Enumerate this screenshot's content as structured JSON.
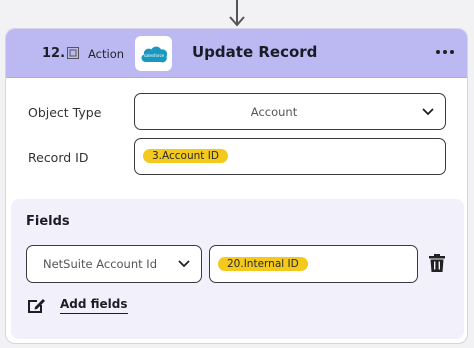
{
  "step": {
    "number": "12.",
    "type": "Action",
    "title": "Update Record"
  },
  "app": {
    "name": "salesforce",
    "brand_color": "#1798c1"
  },
  "form": {
    "object_type": {
      "label": "Object Type",
      "value": "Account"
    },
    "record_id": {
      "label": "Record ID",
      "token": "3.Account ID"
    }
  },
  "fields": {
    "title": "Fields",
    "rows": [
      {
        "field": "NetSuite Account Id",
        "token": "20.Internal ID"
      }
    ],
    "add_label": "Add fields"
  },
  "colors": {
    "header_bg": "#bcb9f2",
    "token_bg": "#f4c91d",
    "fields_bg": "#f2f1fb"
  }
}
